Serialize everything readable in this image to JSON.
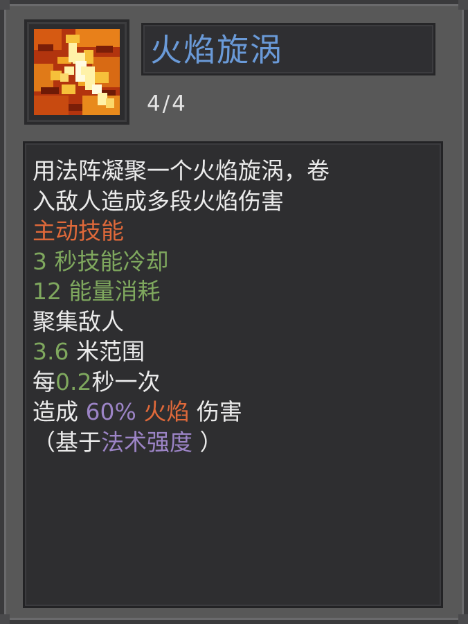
{
  "skill": {
    "name": "火焰旋涡",
    "level": "4/4",
    "icon": "fire-vortex-icon",
    "description": [
      "用法阵凝聚一个火焰旋涡，卷",
      "入敌人造成多段火焰伤害"
    ],
    "type": "主动技能",
    "cooldown": {
      "value": "3",
      "label": "秒技能冷却"
    },
    "cost": {
      "value": "12",
      "label": "能量消耗"
    },
    "effect": "聚集敌人",
    "range": {
      "value": "3.6",
      "label": "米范围"
    },
    "interval": {
      "prefix": "每",
      "value": "0.2",
      "suffix": "秒一次"
    },
    "damage": {
      "prefix": "造成",
      "percent": "60%",
      "element": "火焰",
      "suffix": "伤害"
    },
    "scaling": {
      "open": "（基于",
      "stat": "法术强度",
      "close": "）"
    }
  },
  "colors": {
    "name": "#6a9ad8",
    "active_skill": "#e0693a",
    "stat_value": "#7fa85e",
    "percent": "#9c84c6",
    "element": "#e0693a",
    "panel": "#585858"
  }
}
